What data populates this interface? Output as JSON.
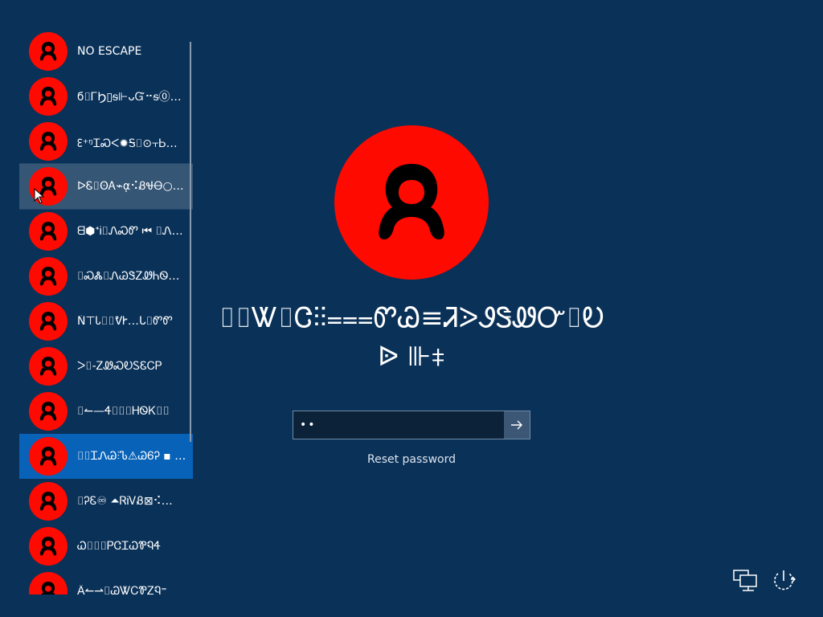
{
  "colors": {
    "background": "#0a3158",
    "avatar_red": "#ff0a00",
    "selected": "#0862b8"
  },
  "users": [
    {
      "name": "NO ESCAPE",
      "state": "normal"
    },
    {
      "name": "ϭ⌷ᎱϦ▯ᵴ⊩ᴗᏳ⠒ᵴ⓪ᏇꝎ",
      "state": "normal"
    },
    {
      "name": "ᢄ⁺ᵑᏆᏍᐸ✹Ꭶ⌷⊙⫟Ꮟ…",
      "state": "normal"
    },
    {
      "name": "ᐅᏋ⌷ʘᎪ⌁ᾳ⠪ᏰᏠᎾ○Ꮭ…",
      "state": "hover"
    },
    {
      "name": "ᗺ⬢ᐩᎥ⌷ᏁᏍᏛ ⏮ ⌷Ꮑ…",
      "state": "normal"
    },
    {
      "name": "⌷ᏍᏜ⌷ᏁᏊᏕᏃᏪᏂᏫ…",
      "state": "normal"
    },
    {
      "name": "Ṅ⊤Ꮣ⌷⌷ᕓᎨ…ᒐ⌷ᏛᏛ",
      "state": "normal"
    },
    {
      "name": "ᐳ⌷-ᏃᏪᏍᎧᏚᏋᏟᏢ",
      "state": "normal"
    },
    {
      "name": "⌷↼—Ꮞ⌷⌷⌷ᎻᏫᏦ⌷⌷",
      "state": "normal"
    },
    {
      "name": "⌷⌷ᏆᏁᏊ⫶Ꮦ⚠ᏊᏮᎮ ▪ …",
      "state": "selected"
    },
    {
      "name": "⌷ᎮᏋ♾ ⏶ᏒᎥᏙᏰ⊠⠪…",
      "state": "normal"
    },
    {
      "name": "Ꮗ⌷⌷⌷ᏢᏣᏆᏇᏈᏄᏎ",
      "state": "normal"
    },
    {
      "name": "Â↼⇀⌷ᏊᏔᏟᏈᏃᏄ⁼",
      "state": "normal"
    }
  ],
  "main": {
    "display_name": "⌷⌷Ꮤ⌷Ꮳ⫶⫶⩶ᏛᏊ≡ᏘᐷᏭᏕᏪᏅ⌷Ꭷᐉ ⊪⧧",
    "password_mask": "••",
    "reset_label": "Reset password"
  },
  "icons": {
    "user_avatar": "person-icon",
    "submit": "arrow-right-icon",
    "network": "network-icon",
    "power": "power-icon",
    "cursor": "mouse-pointer-icon"
  }
}
